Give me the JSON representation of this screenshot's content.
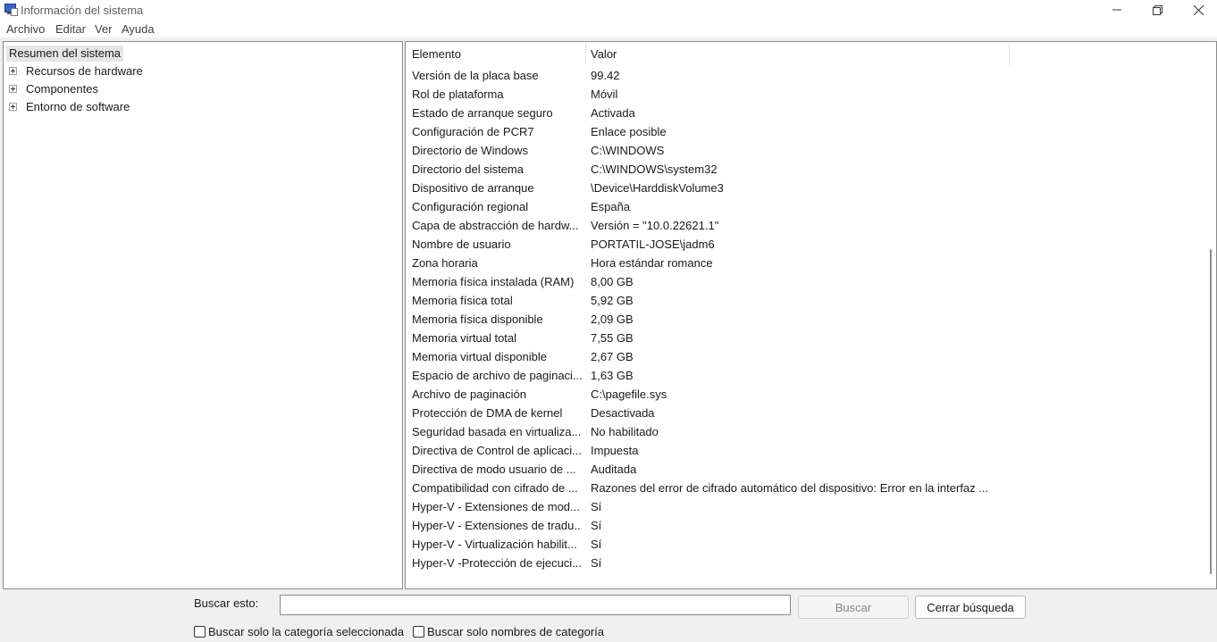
{
  "window": {
    "title": "Información del sistema"
  },
  "menu": [
    "Archivo",
    "Editar",
    "Ver",
    "Ayuda"
  ],
  "tree": {
    "root": "Resumen del sistema",
    "children": [
      "Recursos de hardware",
      "Componentes",
      "Entorno de software"
    ]
  },
  "list": {
    "headers": {
      "element": "Elemento",
      "value": "Valor"
    },
    "rows": [
      {
        "element": "Versión de la placa base",
        "value": "99.42"
      },
      {
        "element": "Rol de plataforma",
        "value": "Móvil"
      },
      {
        "element": "Estado de arranque seguro",
        "value": "Activada"
      },
      {
        "element": "Configuración de PCR7",
        "value": "Enlace posible"
      },
      {
        "element": "Directorio de Windows",
        "value": "C:\\WINDOWS"
      },
      {
        "element": "Directorio del sistema",
        "value": "C:\\WINDOWS\\system32"
      },
      {
        "element": "Dispositivo de arranque",
        "value": "\\Device\\HarddiskVolume3"
      },
      {
        "element": "Configuración regional",
        "value": "España"
      },
      {
        "element": "Capa de abstracción de hardw...",
        "value": "Versión = \"10.0.22621.1\""
      },
      {
        "element": "Nombre de usuario",
        "value": "PORTATIL-JOSE\\jadm6"
      },
      {
        "element": "Zona horaria",
        "value": "Hora estándar romance"
      },
      {
        "element": "Memoria física instalada (RAM)",
        "value": "8,00 GB"
      },
      {
        "element": "Memoria física total",
        "value": "5,92 GB"
      },
      {
        "element": "Memoria física disponible",
        "value": "2,09 GB"
      },
      {
        "element": "Memoria virtual total",
        "value": "7,55 GB"
      },
      {
        "element": "Memoria virtual disponible",
        "value": "2,67 GB"
      },
      {
        "element": "Espacio de archivo de paginaci...",
        "value": "1,63 GB"
      },
      {
        "element": "Archivo de paginación",
        "value": "C:\\pagefile.sys"
      },
      {
        "element": "Protección de DMA de kernel",
        "value": "Desactivada"
      },
      {
        "element": "Seguridad basada en virtualiza...",
        "value": "No habilitado"
      },
      {
        "element": "Directiva de Control de aplicaci...",
        "value": "Impuesta"
      },
      {
        "element": "Directiva de modo usuario de ...",
        "value": "Auditada"
      },
      {
        "element": "Compatibilidad con cifrado de ...",
        "value": "Razones del error de cifrado automático del dispositivo: Error en la interfaz ..."
      },
      {
        "element": "Hyper-V - Extensiones de mod...",
        "value": "Sí"
      },
      {
        "element": "Hyper-V - Extensiones de tradu...",
        "value": "Sí"
      },
      {
        "element": "Hyper-V - Virtualización habilit...",
        "value": "Sí"
      },
      {
        "element": "Hyper-V -Protección de ejecuci...",
        "value": "Sí"
      }
    ]
  },
  "search": {
    "label": "Buscar esto:",
    "value": "",
    "search_button": "Buscar",
    "close_button": "Cerrar búsqueda",
    "only_selected_category": "Buscar solo la categoría seleccionada",
    "only_category_names": "Buscar solo nombres de categoría"
  }
}
